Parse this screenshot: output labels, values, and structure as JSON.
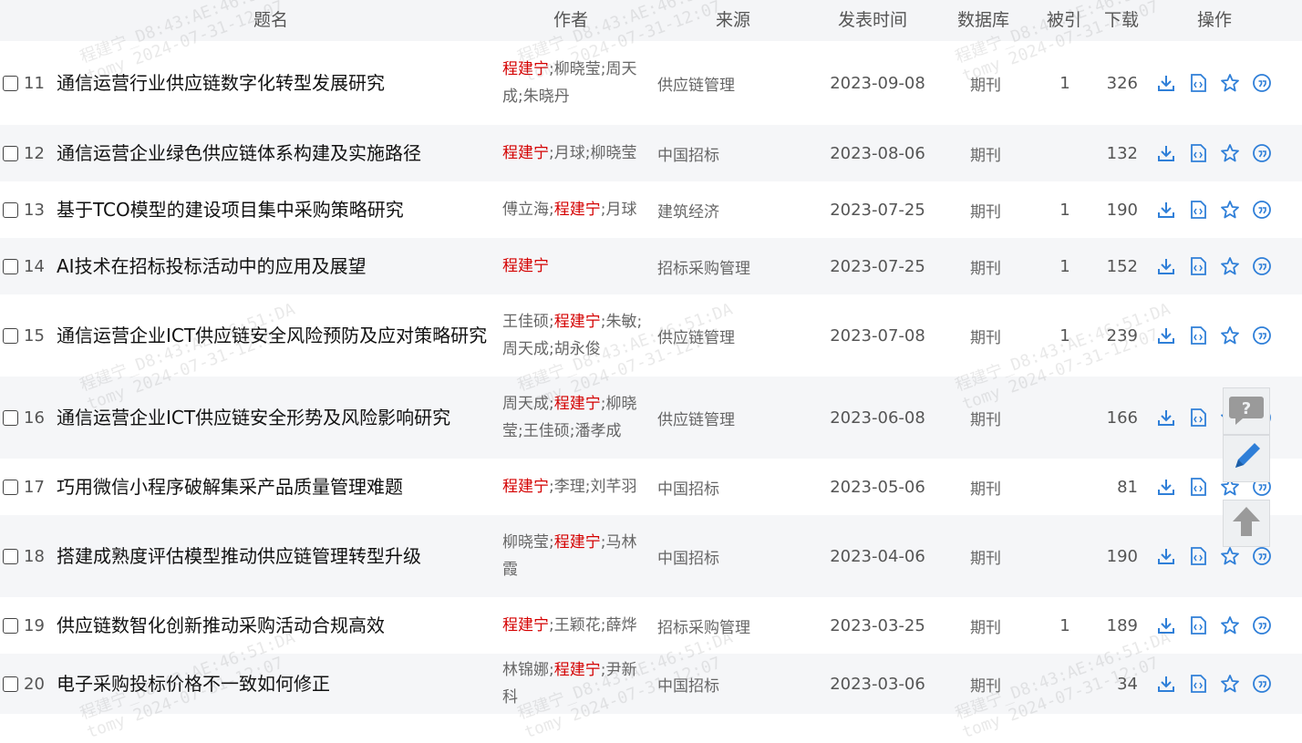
{
  "table": {
    "headers": {
      "title": "题名",
      "author": "作者",
      "source": "来源",
      "date": "发表时间",
      "database": "数据库",
      "cited": "被引",
      "downloads": "下载",
      "operations": "操作"
    },
    "rows": [
      {
        "num": "11",
        "title": "通信运营行业供应链数字化转型发展研究",
        "authors": [
          {
            "name": "程建宁",
            "highlight": true
          },
          {
            "name": ";柳晓莹;周天成;朱晓丹",
            "highlight": false
          }
        ],
        "source": "供应链管理",
        "date": "2023-09-08",
        "database": "期刊",
        "cited": "1",
        "downloads": "326"
      },
      {
        "num": "12",
        "title": "通信运营企业绿色供应链体系构建及实施路径",
        "authors": [
          {
            "name": "程建宁",
            "highlight": true
          },
          {
            "name": ";月球;柳晓莹",
            "highlight": false
          }
        ],
        "source": "中国招标",
        "date": "2023-08-06",
        "database": "期刊",
        "cited": "",
        "downloads": "132"
      },
      {
        "num": "13",
        "title": "基于TCO模型的建设项目集中采购策略研究",
        "authors": [
          {
            "name": "傅立海;",
            "highlight": false
          },
          {
            "name": "程建宁",
            "highlight": true
          },
          {
            "name": ";月球",
            "highlight": false
          }
        ],
        "source": "建筑经济",
        "date": "2023-07-25",
        "database": "期刊",
        "cited": "1",
        "downloads": "190"
      },
      {
        "num": "14",
        "title": "AI技术在招标投标活动中的应用及展望",
        "authors": [
          {
            "name": "程建宁",
            "highlight": true
          }
        ],
        "source": "招标采购管理",
        "date": "2023-07-25",
        "database": "期刊",
        "cited": "1",
        "downloads": "152"
      },
      {
        "num": "15",
        "title": "通信运营企业ICT供应链安全风险预防及应对策略研究",
        "authors": [
          {
            "name": "王佳硕;",
            "highlight": false
          },
          {
            "name": "程建宁",
            "highlight": true
          },
          {
            "name": ";朱敏;周天成;胡永俊",
            "highlight": false
          }
        ],
        "source": "供应链管理",
        "date": "2023-07-08",
        "database": "期刊",
        "cited": "1",
        "downloads": "239"
      },
      {
        "num": "16",
        "title": "通信运营企业ICT供应链安全形势及风险影响研究",
        "authors": [
          {
            "name": "周天成;",
            "highlight": false
          },
          {
            "name": "程建宁",
            "highlight": true
          },
          {
            "name": ";柳晓莹;王佳硕;潘孝成",
            "highlight": false
          }
        ],
        "source": "供应链管理",
        "date": "2023-06-08",
        "database": "期刊",
        "cited": "",
        "downloads": "166"
      },
      {
        "num": "17",
        "title": "巧用微信小程序破解集采产品质量管理难题",
        "authors": [
          {
            "name": "程建宁",
            "highlight": true
          },
          {
            "name": ";李理;刘芊羽",
            "highlight": false
          }
        ],
        "source": "中国招标",
        "date": "2023-05-06",
        "database": "期刊",
        "cited": "",
        "downloads": "81"
      },
      {
        "num": "18",
        "title": "搭建成熟度评估模型推动供应链管理转型升级",
        "authors": [
          {
            "name": "柳晓莹;",
            "highlight": false
          },
          {
            "name": "程建宁",
            "highlight": true
          },
          {
            "name": ";马林霞",
            "highlight": false
          }
        ],
        "source": "中国招标",
        "date": "2023-04-06",
        "database": "期刊",
        "cited": "",
        "downloads": "190"
      },
      {
        "num": "19",
        "title": "供应链数智化创新推动采购活动合规高效",
        "authors": [
          {
            "name": "程建宁",
            "highlight": true
          },
          {
            "name": ";王颖花;薛烨",
            "highlight": false
          }
        ],
        "source": "招标采购管理",
        "date": "2023-03-25",
        "database": "期刊",
        "cited": "1",
        "downloads": "189"
      },
      {
        "num": "20",
        "title": "电子采购投标价格不一致如何修正",
        "authors": [
          {
            "name": "林锦娜;",
            "highlight": false
          },
          {
            "name": "程建宁",
            "highlight": true
          },
          {
            "name": ";尹新科",
            "highlight": false
          }
        ],
        "source": "中国招标",
        "date": "2023-03-06",
        "database": "期刊",
        "cited": "",
        "downloads": "34"
      }
    ]
  },
  "row_actions": [
    "download-icon",
    "html-read-icon",
    "favorite-star-icon",
    "quote-icon"
  ],
  "float_buttons": [
    "help-question-icon",
    "edit-pencil-icon",
    "back-to-top-icon"
  ],
  "watermark": {
    "line1": "程建宁_D8:43:AE:46:51:DA",
    "line2": "tomy 2024-07-31-12:07"
  },
  "colors": {
    "highlight_author": "#d40000",
    "icon_blue": "#2f7fd8",
    "header_bg": "#f4f5f7"
  }
}
